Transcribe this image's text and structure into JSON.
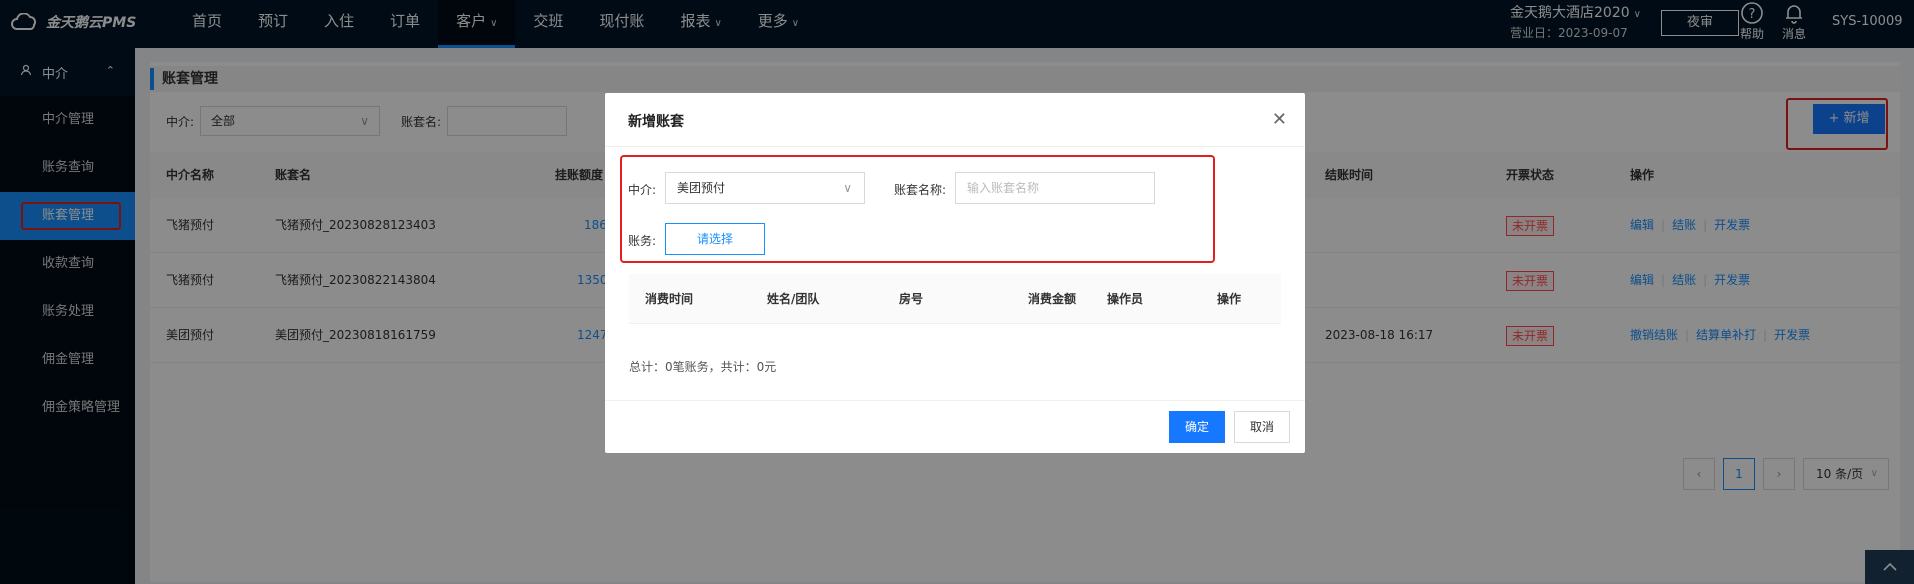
{
  "app": {
    "logo_text": "金天鹅云PMS"
  },
  "nav": {
    "items": [
      {
        "label": "首页"
      },
      {
        "label": "预订"
      },
      {
        "label": "入住"
      },
      {
        "label": "订单"
      },
      {
        "label": "客户",
        "active": true,
        "dropdown": true
      },
      {
        "label": "交班"
      },
      {
        "label": "现付账"
      },
      {
        "label": "报表",
        "dropdown": true
      },
      {
        "label": "更多",
        "dropdown": true
      }
    ]
  },
  "header": {
    "hotel_name": "金天鹅大酒店2020",
    "business_date": "营业日：2023-09-07",
    "night_audit": "夜审",
    "help": "帮助",
    "message": "消息",
    "user": "SYS-10009"
  },
  "sidebar": {
    "group": "中介",
    "items": [
      {
        "label": "中介管理"
      },
      {
        "label": "账务查询"
      },
      {
        "label": "账套管理",
        "active": true
      },
      {
        "label": "收款查询"
      },
      {
        "label": "账务处理"
      },
      {
        "label": "佣金管理"
      },
      {
        "label": "佣金策略管理"
      }
    ]
  },
  "page": {
    "title": "账套管理",
    "filter_agent_label": "中介:",
    "filter_agent_value": "全部",
    "filter_name_label": "账套名:",
    "add_button": "+ 新增"
  },
  "table": {
    "columns": [
      "中介名称",
      "账套名",
      "挂账额度",
      "结账时间",
      "开票状态",
      "操作"
    ],
    "rows": [
      {
        "agent": "飞猪预付",
        "name": "飞猪预付_20230828123403",
        "amount": "186",
        "checkout": "",
        "status": "未开票",
        "ops": [
          "编辑",
          "结账",
          "开发票"
        ]
      },
      {
        "agent": "飞猪预付",
        "name": "飞猪预付_20230822143804",
        "amount": "1350",
        "checkout": "",
        "status": "未开票",
        "ops": [
          "编辑",
          "结账",
          "开发票"
        ]
      },
      {
        "agent": "美团预付",
        "name": "美团预付_20230818161759",
        "amount": "1247",
        "checkout": "2023-08-18 16:17",
        "status": "未开票",
        "ops": [
          "撤销结账",
          "结算单补打",
          "开发票"
        ]
      }
    ]
  },
  "pagination": {
    "current": "1",
    "page_size": "10 条/页"
  },
  "modal": {
    "title": "新增账套",
    "agent_label": "中介:",
    "agent_value": "美团预付",
    "name_label": "账套名称:",
    "name_placeholder": "输入账套名称",
    "account_label": "账务:",
    "choose_button": "请选择",
    "columns": [
      "消费时间",
      "姓名/团队",
      "房号",
      "消费金额",
      "操作员",
      "操作"
    ],
    "summary": "总计：0笔账务，共计：0元",
    "ok": "确定",
    "cancel": "取消"
  },
  "colors": {
    "primary": "#1677ff",
    "sidebar_bg": "#000c17",
    "topbar_bg": "#001529",
    "highlight": "#e02020"
  }
}
